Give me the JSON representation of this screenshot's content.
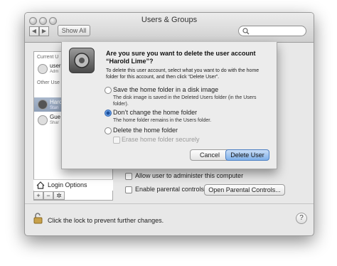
{
  "window": {
    "title": "Users & Groups"
  },
  "toolbar": {
    "back": "◀",
    "forward": "▶",
    "show_all": "Show All"
  },
  "sidebar": {
    "current_user_heading": "Current U",
    "current_user": {
      "name": "user",
      "role": "Adm"
    },
    "other_users_heading": "Other Use",
    "users": [
      {
        "name": "Harold",
        "role": "Stan"
      },
      {
        "name": "Gue",
        "role": "Shar"
      }
    ],
    "login_options": "Login Options",
    "add": "+",
    "remove": "−",
    "gear": "✲"
  },
  "main": {
    "allow_admin": "Allow user to administer this computer",
    "parental_controls": "Enable parental controls",
    "open_parental": "Open Parental Controls..."
  },
  "footer": {
    "lock_text": "Click the lock to prevent further changes.",
    "help": "?"
  },
  "sheet": {
    "title": "Are you sure you want to delete the user account “Harold Lime”?",
    "message": "To delete this user account, select what you want to do with the home folder for this account, and then click “Delete User”.",
    "options": [
      {
        "label": "Save the home folder in a disk image",
        "desc": "The disk image is saved in the Deleted Users folder (in the Users folder).",
        "selected": false
      },
      {
        "label": "Don’t change the home folder",
        "desc": "The home folder remains in the Users folder.",
        "selected": true
      },
      {
        "label": "Delete the home folder",
        "desc": "",
        "selected": false
      }
    ],
    "erase_label": "Erase home folder securely",
    "cancel": "Cancel",
    "delete": "Delete User"
  },
  "colors": {
    "accent": "#3c79cf",
    "selection": "#9aabc3"
  }
}
